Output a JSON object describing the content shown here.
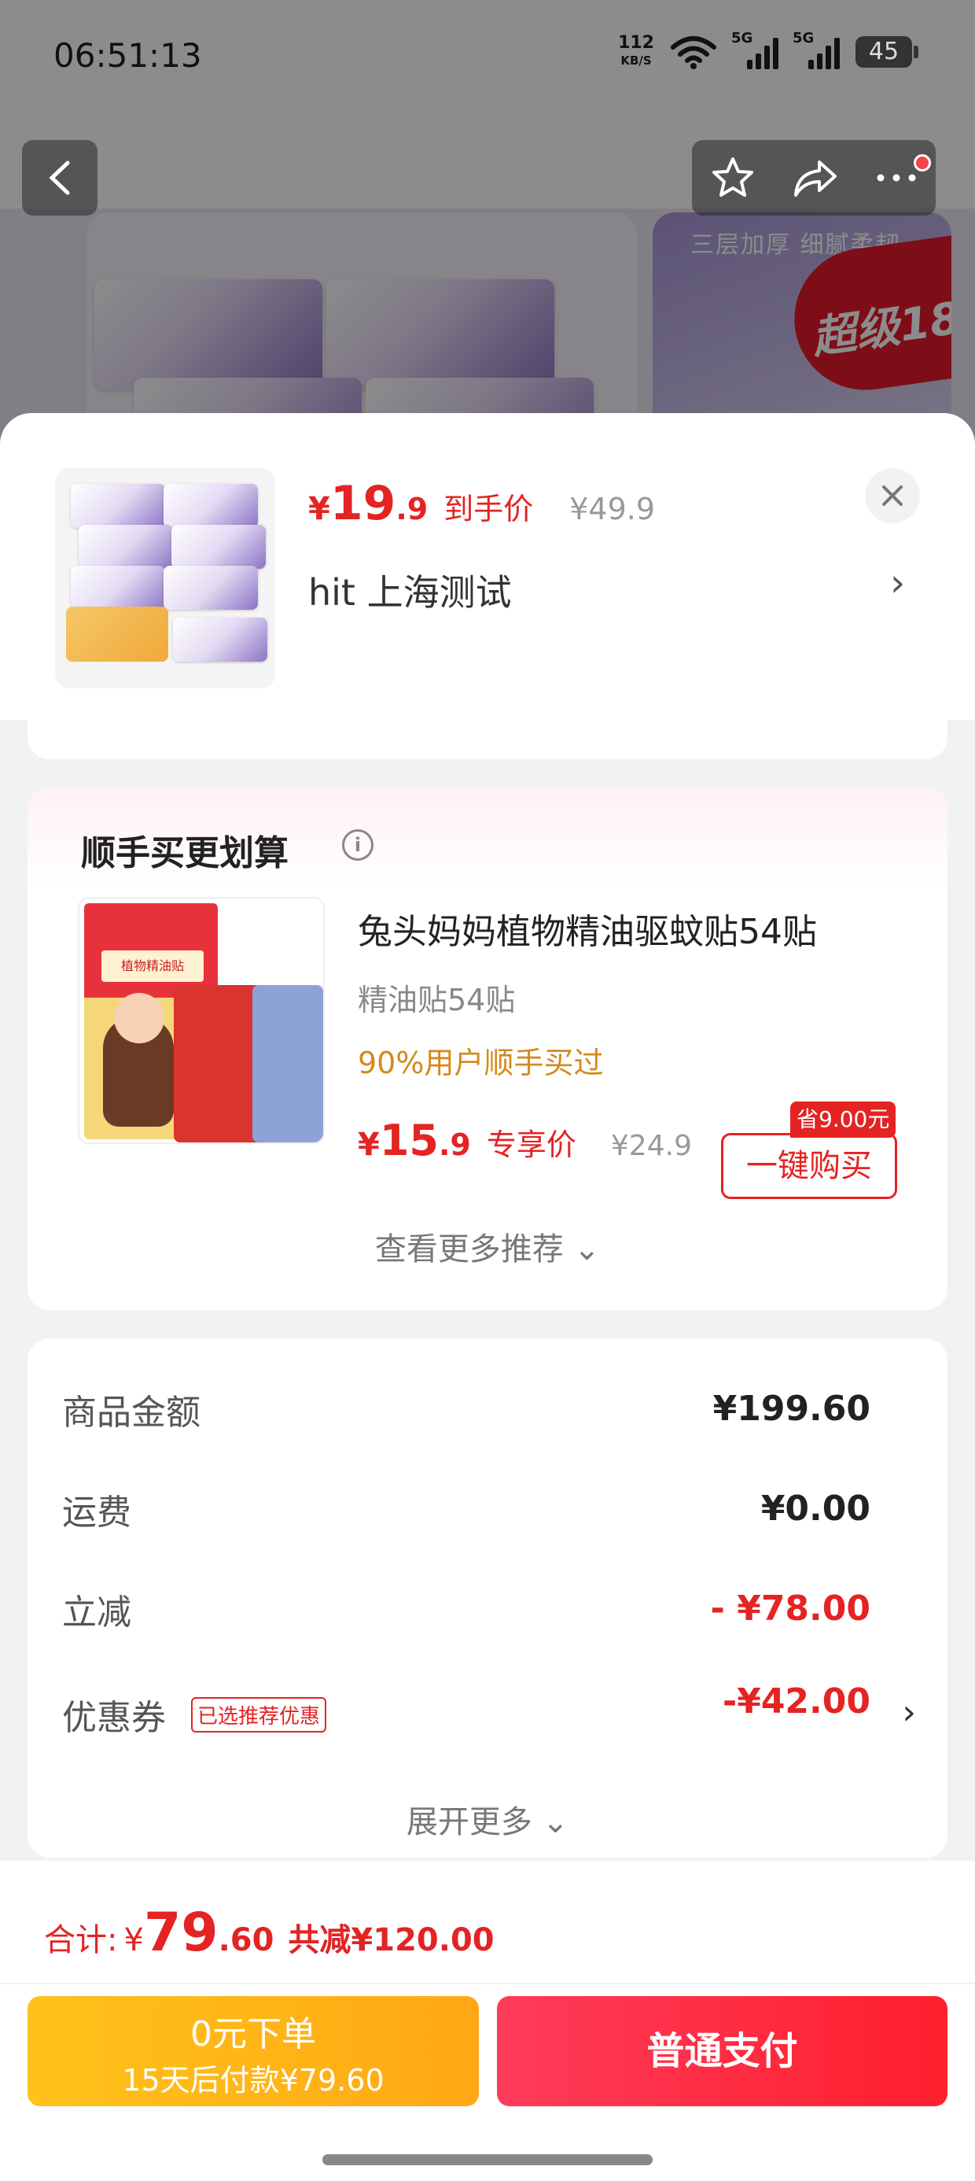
{
  "status_bar": {
    "time": "06:51:13",
    "net_speed": "112",
    "net_unit": "KB/S",
    "signal1_label": "5G",
    "signal2_label": "5G",
    "battery": "45"
  },
  "background": {
    "banner_text": "三层加厚 细腻柔韧",
    "badge_text": "超级18"
  },
  "product": {
    "price_yen": "¥",
    "price_int": "19",
    "price_dec": ".9",
    "price_tag": "到手价",
    "orig_price": "¥49.9",
    "address": "hit  上海测试"
  },
  "recommend": {
    "title": "顺手买更划算",
    "item_name": "兔头妈妈植物精油驱蚊贴54贴",
    "item_spec": "精油贴54贴",
    "item_social": "90%用户顺手买过",
    "item_price_yen": "¥",
    "item_price_int": "15",
    "item_price_dec": ".9",
    "item_price_tag": "专享价",
    "item_orig_price": "¥24.9",
    "save_badge": "省9.00元",
    "buy_label": "一键购买",
    "more_label": "查看更多推荐 ⌄",
    "pack_label": "植物精油贴"
  },
  "summary": {
    "rows": [
      {
        "label": "商品金额",
        "value": "¥199.60"
      },
      {
        "label": "运费",
        "value": "¥0.00"
      },
      {
        "label": "立减",
        "value": "- ¥78.00"
      },
      {
        "label": "优惠券",
        "value": "-¥42.00"
      }
    ],
    "coupon_tag": "已选推荐优惠",
    "expand_label": "展开更多 ⌄"
  },
  "footer": {
    "total_label": "合计:",
    "total_yen": "¥",
    "total_int": "79",
    "total_dec": ".60",
    "discount": "共减¥120.00",
    "zero_title": "0元下单",
    "zero_sub": "15天后付款¥79.60",
    "pay_label": "普通支付"
  },
  "colors": {
    "accent_red": "#e42323",
    "pay_gradient_start": "#ff3b5a",
    "zero_gradient_start": "#ffc21a",
    "social_orange": "#d48a1a"
  },
  "icons": [
    "back-arrow-icon",
    "star-icon",
    "share-icon",
    "more-icon",
    "close-icon",
    "chevron-right-icon",
    "info-icon",
    "wifi-icon"
  ]
}
